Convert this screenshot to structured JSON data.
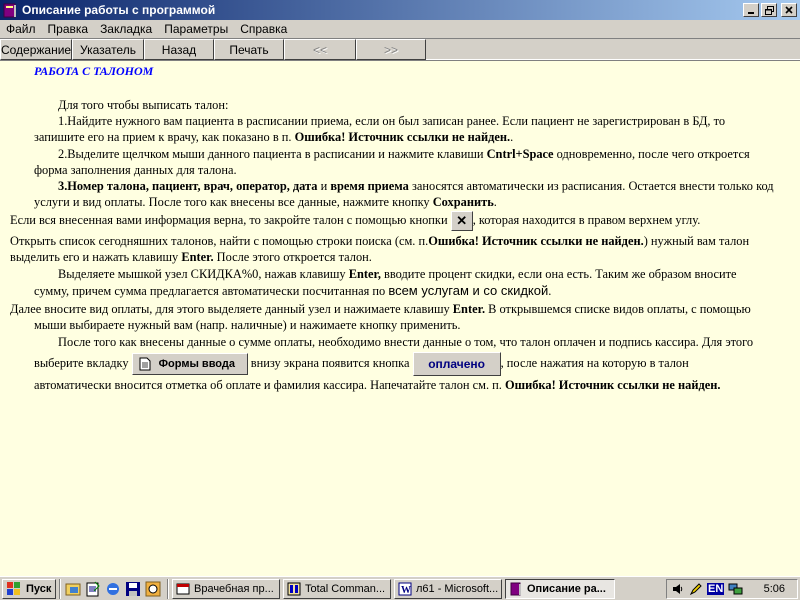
{
  "window": {
    "title": "Описание  работы с программой"
  },
  "menu": [
    "Файл",
    "Правка",
    "Закладка",
    "Параметры",
    "Справка"
  ],
  "toolbar": {
    "contents": "Содержание",
    "index": "Указатель",
    "back": "Назад",
    "print": "Печать",
    "prev": "<<",
    "next": ">>"
  },
  "doc": {
    "heading": "РАБОТА С ТАЛОНОМ",
    "intro": "Для того чтобы выписать талон:",
    "s1a": "1.Найдите нужного вам пациента в расписании приема, если он был записан ранее. Если пациент не зарегистрирован в БД, то",
    "s1b": "запишите его на прием к врачу, как показано в п. ",
    "s1err": "Ошибка! Источник ссылки не найден.",
    "s1end": ".",
    "s2a": "2.Выделите щелчком мыши данного пациента в расписании и нажмите клавиши ",
    "s2keys": "Cntrl+Space",
    "s2b": " одновременно, после чего откроется",
    "s2c": "форма заполнения данных для талона.",
    "s3num": "3.Номер талона, пациент, врач, оператор, дата",
    "s3and": " и ",
    "s3time": "время приема",
    "s3rest": " заносятся автоматически из расписания. Остается внести только код",
    "s3b": "услуги и вид оплаты. После того как внесены все данные, нажмите кнопку ",
    "s3save": "Сохранить",
    "s3end": ".",
    "p4a": "Если вся внесенная вами информация верна, то закройте талон с помощью кнопки ",
    "closebtn": "✕",
    "p4b": ", которая находится в правом верхнем углу.",
    "p5a": "Открыть список сегодняшних талонов, найти с помощью строки поиска (см. п.",
    "p5err": "Ошибка! Источник ссылки не найден.",
    "p5b": ")  нужный вам талон",
    "p5c": "выделить его и нажать клавишу ",
    "p5enter": "Enter.",
    "p5d": " После этого откроется талон.",
    "p6a": "Выделяете мышкой узел СКИДКА%0,  нажав клавишу ",
    "p6enter": "Enter,",
    "p6b": " вводите процент скидки, если она есть. Таким же образом вносите",
    "p6c": "сумму, причем сумма предлагается автоматически посчитанная по ",
    "p6d": "всем услугам и со скидкой",
    "p6e": ".",
    "p7a": "Далее вносите вид оплаты, для этого выделяете данный узел и нажимаете клавишу ",
    "p7enter": "Enter.",
    "p7b": " В открывшемся списке видов оплаты, с помощью",
    "p7c": "мыши выбираете нужный вам (напр. наличные) и нажимаете кнопку применить.",
    "p8a": "После того как внесены данные о сумме оплаты, необходимо внести данные о том, что талон оплачен и подпись кассира. Для этого",
    "p8b": "выберите вкладку ",
    "formsbtn": "Формы ввода",
    "p8c": " внизу экрана появится кнопка ",
    "paidbtn": "оплачено",
    "p8d": ", после нажатия на которую в талон",
    "p8e": "автоматически вносится отметка об оплате и фамилия кассира.  Напечатайте талон см. п. ",
    "p8err": "Ошибка! Источник ссылки не найден."
  },
  "taskbar": {
    "start": "Пуск",
    "tasks": [
      "Врачебная пр...",
      "Total Comman...",
      "л61 - Microsoft...",
      "Описание  ра..."
    ],
    "lang": "EN",
    "time": "5:06"
  }
}
